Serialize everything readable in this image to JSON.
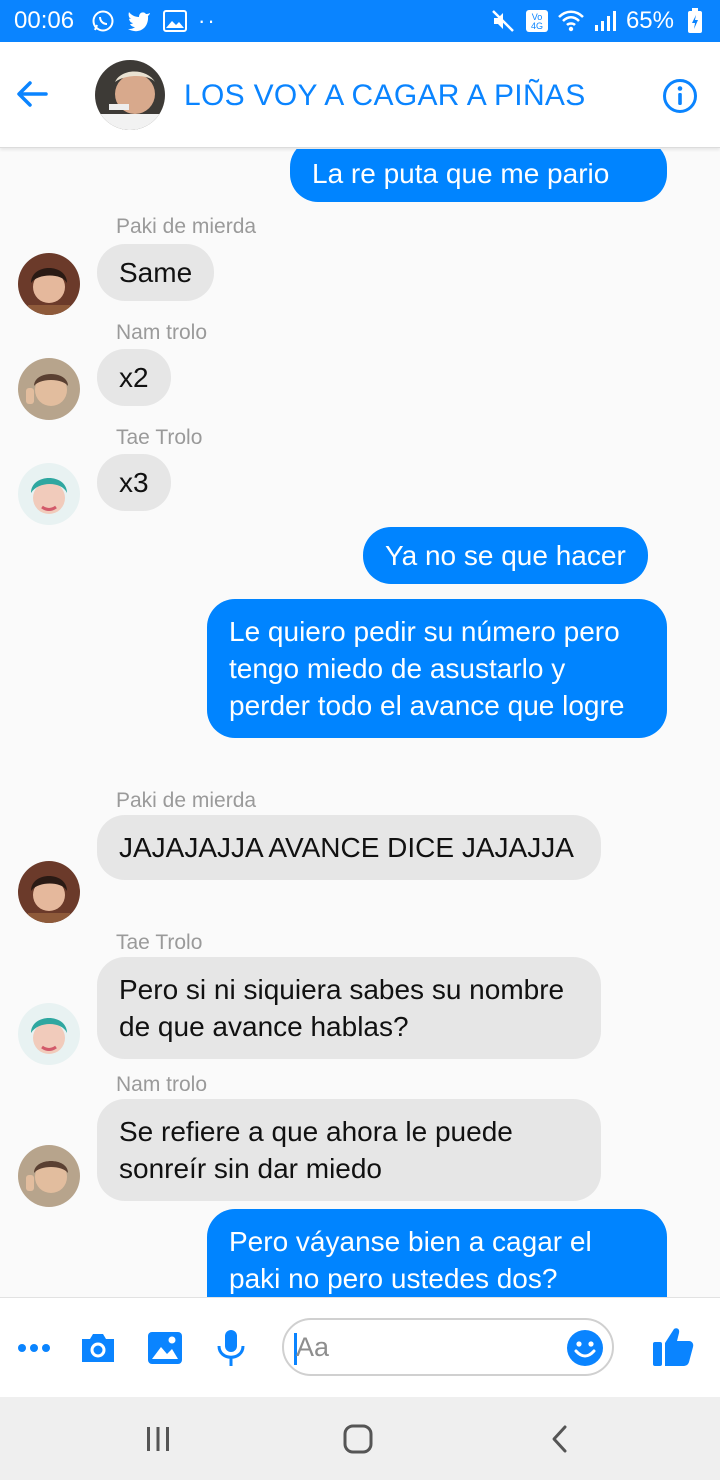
{
  "status_bar": {
    "time": "00:06",
    "battery": "65%"
  },
  "header": {
    "title": "LOS VOY A CAGAR A PIÑAS"
  },
  "messages": [
    {
      "text": "La re puta que me pario"
    },
    {
      "sender": "Paki de mierda",
      "text": "Same"
    },
    {
      "sender": "Nam trolo",
      "text": "x2"
    },
    {
      "sender": "Tae Trolo",
      "text": "x3"
    },
    {
      "text": "Ya no se que hacer"
    },
    {
      "text": "Le quiero pedir su número pero tengo miedo de asustarlo y perder todo el avance que logre"
    },
    {
      "sender": "Paki de mierda",
      "text": "JAJAJAJJA AVANCE DICE JAJAJJA"
    },
    {
      "sender": "Tae Trolo",
      "text": "Pero si ni siquiera sabes su nombre de que avance hablas?"
    },
    {
      "sender": "Nam trolo",
      "text": "Se refiere a que ahora le puede sonreír sin dar miedo"
    },
    {
      "text": "Pero váyanse bien a cagar el paki no pero ustedes dos?"
    }
  ],
  "composer": {
    "placeholder": "Aa"
  },
  "colors": {
    "accent": "#0a84ff",
    "outgoing_bubble": "#0084ff",
    "incoming_bubble": "#e6e6e6"
  },
  "icons": [
    "whatsapp-icon",
    "twitter-icon",
    "gallery-icon",
    "mute-icon",
    "volte-icon",
    "wifi-icon",
    "signal-icon",
    "battery-icon",
    "back-arrow-icon",
    "info-icon",
    "more-icon",
    "camera-icon",
    "image-icon",
    "microphone-icon",
    "emoji-icon",
    "like-icon",
    "recent-apps-icon",
    "home-icon",
    "back-icon"
  ]
}
